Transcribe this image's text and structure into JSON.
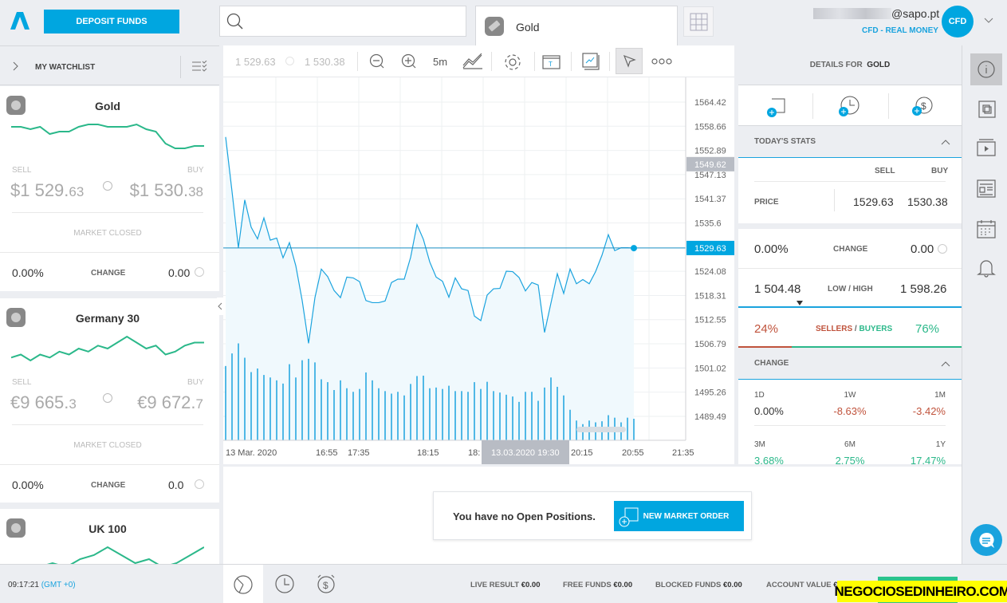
{
  "header": {
    "deposit_label": "DEPOSIT FUNDS",
    "search_placeholder": "",
    "tab_label": "Gold",
    "email": "@sapo.pt",
    "account_type": "CFD - REAL MONEY",
    "avatar": "CFD"
  },
  "watchlist": {
    "title": "MY WATCHLIST",
    "items": [
      {
        "name": "Gold",
        "sell_label": "SELL",
        "buy_label": "BUY",
        "sell_main": "$1 529.",
        "sell_dec": "63",
        "buy_main": "$1 530.",
        "buy_dec": "38",
        "status": "MARKET CLOSED",
        "change_pct": "0.00%",
        "change_label": "CHANGE",
        "change_val": "0.00",
        "spark": [
          5,
          5,
          4,
          5,
          2,
          3,
          3,
          5,
          6,
          6,
          5,
          5,
          5,
          6,
          4,
          3,
          -2,
          -4,
          -4,
          -3,
          -3
        ]
      },
      {
        "name": "Germany 30",
        "sell_label": "SELL",
        "buy_label": "BUY",
        "sell_main": "€9 665.",
        "sell_dec": "3",
        "buy_main": "€9 672.",
        "buy_dec": "7",
        "status": "MARKET CLOSED",
        "change_pct": "0.00%",
        "change_label": "CHANGE",
        "change_val": "0.0",
        "spark": [
          0,
          1,
          -1,
          1,
          0,
          2,
          1,
          3,
          2,
          4,
          3,
          5,
          7,
          5,
          3,
          4,
          1,
          2,
          4,
          5,
          5
        ]
      },
      {
        "name": "UK 100",
        "spark": [
          0,
          -1,
          0,
          1,
          0,
          2,
          3,
          5,
          3,
          1,
          2,
          0,
          1,
          3,
          5
        ]
      }
    ]
  },
  "chart": {
    "sell": "1 529.63",
    "buy": "1 530.38",
    "interval": "5m",
    "crosshair_label": "13.03.2020 19:30"
  },
  "chart_data": {
    "type": "line",
    "xlabel": "",
    "ylabel": "",
    "x_ticks": [
      "13 Mar. 2020",
      "16:55",
      "17:35",
      "18:15",
      "18:",
      "20:15",
      "20:55",
      "21:35"
    ],
    "y_ticks": [
      1564.42,
      1558.66,
      1552.89,
      1547.13,
      1541.37,
      1535.6,
      1529.63,
      1524.08,
      1518.31,
      1512.55,
      1506.79,
      1501.02,
      1495.26,
      1489.49
    ],
    "ylim": [
      1484,
      1569
    ],
    "hover_price": "1549.62",
    "last_price": "1529.63",
    "prices": [
      1556.1,
      1543.1,
      1529.7,
      1541.1,
      1534.6,
      1531.8,
      1536.8,
      1531.5,
      1532.0,
      1527.3,
      1530.9,
      1525.4,
      1517.1,
      1506.9,
      1517.8,
      1524.6,
      1522.8,
      1519.5,
      1517.8,
      1522.7,
      1522.5,
      1521.6,
      1517.1,
      1516.6,
      1516.6,
      1517.0,
      1521.4,
      1522.2,
      1522.2,
      1527.4,
      1535.2,
      1531.7,
      1526.3,
      1522.7,
      1521.7,
      1517.9,
      1522.5,
      1519.9,
      1519.5,
      1513.4,
      1512.3,
      1518.4,
      1519.9,
      1520.0,
      1524.1,
      1524.0,
      1522.6,
      1519.4,
      1521.4,
      1520.8,
      1509.5,
      1516.5,
      1523.5,
      1518.8,
      1524.6,
      1521.1,
      1522.1,
      1521.1,
      1524.0,
      1527.9,
      1532.8,
      1529.0,
      1529.7,
      1529.7,
      1529.6
    ],
    "volume": [
      207,
      242,
      270,
      230,
      190,
      200,
      182,
      175,
      167,
      158,
      212,
      175,
      223,
      227,
      217,
      170,
      162,
      140,
      167,
      145,
      135,
      143,
      189,
      167,
      145,
      137,
      130,
      135,
      125,
      157,
      179,
      180,
      145,
      147,
      143,
      152,
      137,
      137,
      135,
      162,
      143,
      163,
      137,
      133,
      127,
      122,
      107,
      135,
      135,
      110,
      147,
      175,
      149,
      125,
      85,
      55,
      45,
      55,
      50,
      53,
      70,
      63,
      50,
      63,
      60
    ],
    "colors": {
      "line": "#1aa3de",
      "fill": "#f0f9fd",
      "last": "#00a6e0",
      "hover": "#b8bcc4"
    }
  },
  "positions": {
    "empty_text": "You have no Open Positions.",
    "new_order": "NEW MARKET ORDER"
  },
  "details": {
    "title_prefix": "DETAILS FOR",
    "title_name": "GOLD",
    "today": {
      "title": "TODAY'S STATS",
      "sell": "SELL",
      "buy": "BUY",
      "price_label": "PRICE",
      "sell_price": "1529.63",
      "buy_price": "1530.38"
    },
    "change_pct": "0.00%",
    "change_label": "CHANGE",
    "change_val": "0.00",
    "low": "1 504.48",
    "lowhigh_label": "LOW / HIGH",
    "high": "1 598.26",
    "sellers_pct": "24%",
    "sellers_label": "SELLERS",
    "slash": " / ",
    "buyers_label": "BUYERS",
    "buyers_pct": "76%",
    "sellers_fraction": 0.24,
    "change_section": "CHANGE",
    "periods": [
      {
        "p": "1D",
        "v": "0.00%",
        "c": "neutral"
      },
      {
        "p": "1W",
        "v": "-8.63%",
        "c": "red"
      },
      {
        "p": "1M",
        "v": "-3.42%",
        "c": "red"
      },
      {
        "p": "3M",
        "v": "3.68%",
        "c": "green"
      },
      {
        "p": "6M",
        "v": "2.75%",
        "c": "green"
      },
      {
        "p": "1Y",
        "v": "17.47%",
        "c": "green"
      }
    ]
  },
  "footer": {
    "time": "09:17:21",
    "tz": "(GMT +0)",
    "live_label": "LIVE RESULT",
    "live": "€0.00",
    "free_label": "FREE FUNDS",
    "free": "€0.00",
    "blocked_label": "BLOCKED FUNDS",
    "blocked": "€0.00",
    "account_label": "ACCOUNT VALUE",
    "account": "€"
  },
  "watermark": "NEGOCIOSEDINHEIRO.COM"
}
